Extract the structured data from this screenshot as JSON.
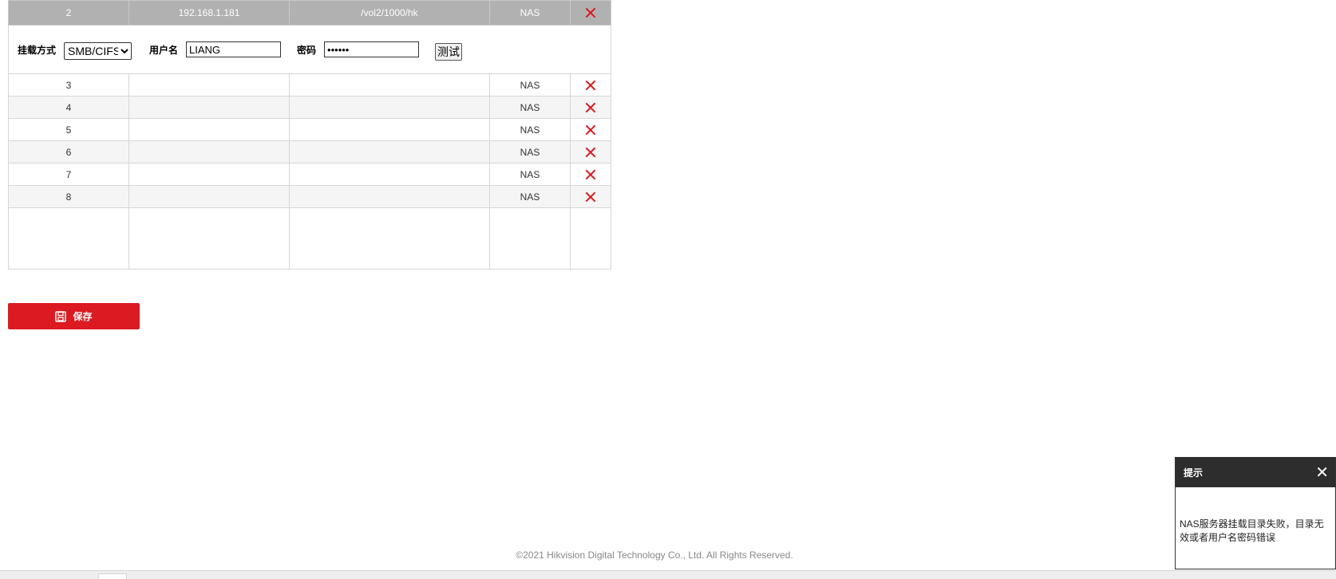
{
  "nas_table": {
    "selected_row": {
      "index": "2",
      "server": "192.168.1.181",
      "path": "/vol2/1000/hk",
      "type": "NAS"
    },
    "mount_options": {
      "mount_label": "挂载方式",
      "mount_value": "SMB/CIFS",
      "username_label": "用户名",
      "username_value": "LIANG",
      "password_label": "密码",
      "password_value": "••••••",
      "test_label": "测试"
    },
    "rows": [
      {
        "index": "3",
        "server": "",
        "path": "",
        "type": "NAS"
      },
      {
        "index": "4",
        "server": "",
        "path": "",
        "type": "NAS"
      },
      {
        "index": "5",
        "server": "",
        "path": "",
        "type": "NAS"
      },
      {
        "index": "6",
        "server": "",
        "path": "",
        "type": "NAS"
      },
      {
        "index": "7",
        "server": "",
        "path": "",
        "type": "NAS"
      },
      {
        "index": "8",
        "server": "",
        "path": "",
        "type": "NAS"
      }
    ]
  },
  "save_button": {
    "label": "保存"
  },
  "footer": {
    "copyright": "©2021 Hikvision Digital Technology Co., Ltd. All Rights Reserved."
  },
  "toast": {
    "title": "提示",
    "close_glyph": "✕",
    "message": "NAS服务器挂载目录失败，目录无效或者用户名密码错误"
  },
  "colors": {
    "accent": "#db1a21",
    "delete_icon": "#d71920",
    "selected_row": "#b1b1b1",
    "toast_header": "#2d2d2d"
  }
}
